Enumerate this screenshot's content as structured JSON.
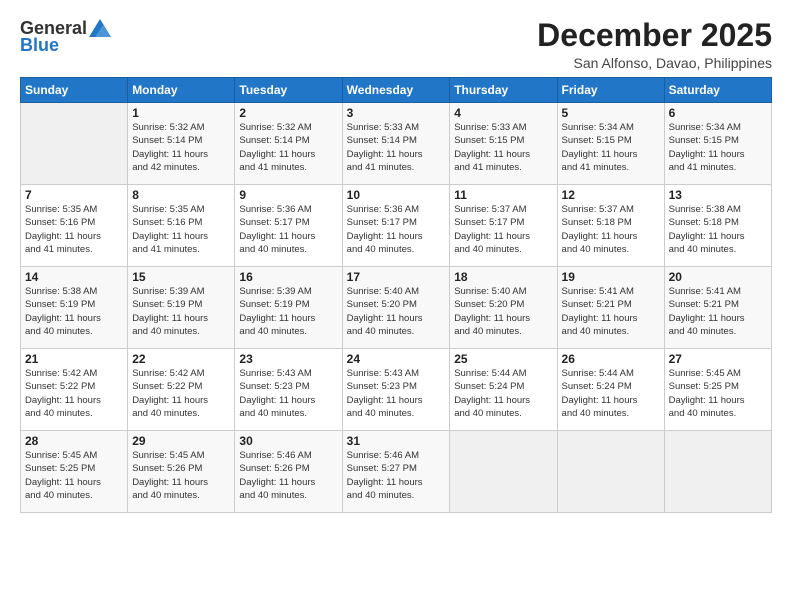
{
  "logo": {
    "general": "General",
    "blue": "Blue"
  },
  "title": "December 2025",
  "subtitle": "San Alfonso, Davao, Philippines",
  "days_header": [
    "Sunday",
    "Monday",
    "Tuesday",
    "Wednesday",
    "Thursday",
    "Friday",
    "Saturday"
  ],
  "weeks": [
    [
      {
        "day": "",
        "info": ""
      },
      {
        "day": "1",
        "info": "Sunrise: 5:32 AM\nSunset: 5:14 PM\nDaylight: 11 hours\nand 42 minutes."
      },
      {
        "day": "2",
        "info": "Sunrise: 5:32 AM\nSunset: 5:14 PM\nDaylight: 11 hours\nand 41 minutes."
      },
      {
        "day": "3",
        "info": "Sunrise: 5:33 AM\nSunset: 5:14 PM\nDaylight: 11 hours\nand 41 minutes."
      },
      {
        "day": "4",
        "info": "Sunrise: 5:33 AM\nSunset: 5:15 PM\nDaylight: 11 hours\nand 41 minutes."
      },
      {
        "day": "5",
        "info": "Sunrise: 5:34 AM\nSunset: 5:15 PM\nDaylight: 11 hours\nand 41 minutes."
      },
      {
        "day": "6",
        "info": "Sunrise: 5:34 AM\nSunset: 5:15 PM\nDaylight: 11 hours\nand 41 minutes."
      }
    ],
    [
      {
        "day": "7",
        "info": "Sunrise: 5:35 AM\nSunset: 5:16 PM\nDaylight: 11 hours\nand 41 minutes."
      },
      {
        "day": "8",
        "info": "Sunrise: 5:35 AM\nSunset: 5:16 PM\nDaylight: 11 hours\nand 41 minutes."
      },
      {
        "day": "9",
        "info": "Sunrise: 5:36 AM\nSunset: 5:17 PM\nDaylight: 11 hours\nand 40 minutes."
      },
      {
        "day": "10",
        "info": "Sunrise: 5:36 AM\nSunset: 5:17 PM\nDaylight: 11 hours\nand 40 minutes."
      },
      {
        "day": "11",
        "info": "Sunrise: 5:37 AM\nSunset: 5:17 PM\nDaylight: 11 hours\nand 40 minutes."
      },
      {
        "day": "12",
        "info": "Sunrise: 5:37 AM\nSunset: 5:18 PM\nDaylight: 11 hours\nand 40 minutes."
      },
      {
        "day": "13",
        "info": "Sunrise: 5:38 AM\nSunset: 5:18 PM\nDaylight: 11 hours\nand 40 minutes."
      }
    ],
    [
      {
        "day": "14",
        "info": "Sunrise: 5:38 AM\nSunset: 5:19 PM\nDaylight: 11 hours\nand 40 minutes."
      },
      {
        "day": "15",
        "info": "Sunrise: 5:39 AM\nSunset: 5:19 PM\nDaylight: 11 hours\nand 40 minutes."
      },
      {
        "day": "16",
        "info": "Sunrise: 5:39 AM\nSunset: 5:19 PM\nDaylight: 11 hours\nand 40 minutes."
      },
      {
        "day": "17",
        "info": "Sunrise: 5:40 AM\nSunset: 5:20 PM\nDaylight: 11 hours\nand 40 minutes."
      },
      {
        "day": "18",
        "info": "Sunrise: 5:40 AM\nSunset: 5:20 PM\nDaylight: 11 hours\nand 40 minutes."
      },
      {
        "day": "19",
        "info": "Sunrise: 5:41 AM\nSunset: 5:21 PM\nDaylight: 11 hours\nand 40 minutes."
      },
      {
        "day": "20",
        "info": "Sunrise: 5:41 AM\nSunset: 5:21 PM\nDaylight: 11 hours\nand 40 minutes."
      }
    ],
    [
      {
        "day": "21",
        "info": "Sunrise: 5:42 AM\nSunset: 5:22 PM\nDaylight: 11 hours\nand 40 minutes."
      },
      {
        "day": "22",
        "info": "Sunrise: 5:42 AM\nSunset: 5:22 PM\nDaylight: 11 hours\nand 40 minutes."
      },
      {
        "day": "23",
        "info": "Sunrise: 5:43 AM\nSunset: 5:23 PM\nDaylight: 11 hours\nand 40 minutes."
      },
      {
        "day": "24",
        "info": "Sunrise: 5:43 AM\nSunset: 5:23 PM\nDaylight: 11 hours\nand 40 minutes."
      },
      {
        "day": "25",
        "info": "Sunrise: 5:44 AM\nSunset: 5:24 PM\nDaylight: 11 hours\nand 40 minutes."
      },
      {
        "day": "26",
        "info": "Sunrise: 5:44 AM\nSunset: 5:24 PM\nDaylight: 11 hours\nand 40 minutes."
      },
      {
        "day": "27",
        "info": "Sunrise: 5:45 AM\nSunset: 5:25 PM\nDaylight: 11 hours\nand 40 minutes."
      }
    ],
    [
      {
        "day": "28",
        "info": "Sunrise: 5:45 AM\nSunset: 5:25 PM\nDaylight: 11 hours\nand 40 minutes."
      },
      {
        "day": "29",
        "info": "Sunrise: 5:45 AM\nSunset: 5:26 PM\nDaylight: 11 hours\nand 40 minutes."
      },
      {
        "day": "30",
        "info": "Sunrise: 5:46 AM\nSunset: 5:26 PM\nDaylight: 11 hours\nand 40 minutes."
      },
      {
        "day": "31",
        "info": "Sunrise: 5:46 AM\nSunset: 5:27 PM\nDaylight: 11 hours\nand 40 minutes."
      },
      {
        "day": "",
        "info": ""
      },
      {
        "day": "",
        "info": ""
      },
      {
        "day": "",
        "info": ""
      }
    ]
  ]
}
